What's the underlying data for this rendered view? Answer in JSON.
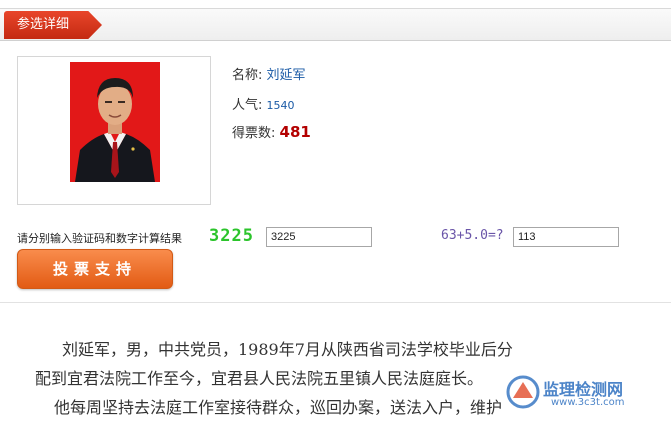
{
  "header": {
    "tab_label": "参选详细"
  },
  "candidate": {
    "name_label": "名称:",
    "name": "刘延军",
    "popularity_label": "人气:",
    "popularity": "1540",
    "votes_label": "得票数:",
    "votes": "481"
  },
  "captcha": {
    "label": "请分别输入验证码和数字计算结果",
    "code": "3225",
    "code_input": "3225",
    "math_question": "63+5.0=?",
    "math_input": "113"
  },
  "vote_button_label": "投票支持",
  "bio": {
    "lines": [
      "刘延军，男，中共党员，1989年7月从陕西省司法学校毕业后分",
      "配到宜君法院工作至今，宜君县人民法院五里镇人民法庭庭长。",
      "他每周坚持去法庭工作室接待群众，巡回办案，送法入户，维护"
    ]
  },
  "watermark": {
    "title": "监理检测网",
    "url": "www.3c3t.com"
  },
  "colors": {
    "tab_red": "#d43a1e",
    "vote_orange": "#ef7430",
    "captcha_green": "#2bc42b",
    "votes_red": "#b30000"
  }
}
